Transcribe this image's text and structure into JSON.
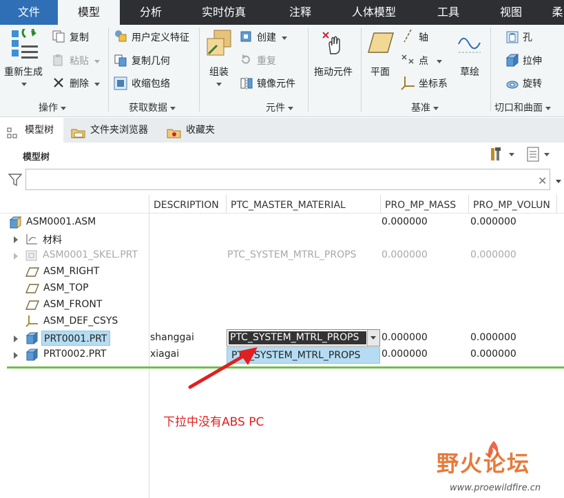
{
  "tabs": [
    "文件",
    "模型",
    "分析",
    "实时仿真",
    "注释",
    "人体模型",
    "工具",
    "视图",
    "柔"
  ],
  "active_tab": "模型",
  "ribbon": {
    "groups": {
      "operations": "操作",
      "get_data": "获取数据",
      "components": "元件",
      "datum": "基准",
      "cut_surface": "切口和曲面"
    },
    "regenerate": "重新生成",
    "copy": "复制",
    "paste": "粘贴",
    "delete": "删除",
    "user_defined_feature": "用户定义特征",
    "copy_geometry": "复制几何",
    "shrinkwrap": "收缩包络",
    "assemble": "组装",
    "create": "创建",
    "repeat": "重复",
    "mirror_component": "镜像元件",
    "drag_components": "拖动元件",
    "plane": "平面",
    "axis": "轴",
    "point": "点",
    "coordinate_system": "坐标系",
    "sketch": "草绘",
    "hole": "孔",
    "extrude": "拉伸",
    "revolve": "旋转"
  },
  "panel_tabs": [
    "模型树",
    "文件夹浏览器",
    "收藏夹"
  ],
  "tree": {
    "header": "模型树",
    "filter_placeholder": "",
    "columns": [
      "DESCRIPTION",
      "PTC_MASTER_MATERIAL",
      "PRO_MP_MASS",
      "PRO_MP_VOLUN"
    ],
    "rows": [
      {
        "name": "ASM0001.ASM",
        "description": "",
        "material": "",
        "mass": "0.000000",
        "volume": "0.000000"
      },
      {
        "name": "材料",
        "description": "",
        "material": "",
        "mass": "",
        "volume": ""
      },
      {
        "name": "ASM0001_SKEL.PRT",
        "description": "",
        "material": "PTC_SYSTEM_MTRL_PROPS",
        "mass": "0.000000",
        "volume": "0.000000"
      },
      {
        "name": "ASM_RIGHT",
        "description": "",
        "material": "",
        "mass": "",
        "volume": ""
      },
      {
        "name": "ASM_TOP",
        "description": "",
        "material": "",
        "mass": "",
        "volume": ""
      },
      {
        "name": "ASM_FRONT",
        "description": "",
        "material": "",
        "mass": "",
        "volume": ""
      },
      {
        "name": "ASM_DEF_CSYS",
        "description": "",
        "material": "",
        "mass": "",
        "volume": ""
      },
      {
        "name": "PRT0001.PRT",
        "description": "shanggai",
        "material": "PTC_SYSTEM_MTRL_PROPS",
        "mass": "0.000000",
        "volume": "0.000000"
      },
      {
        "name": "PRT0002.PRT",
        "description": "xiagai",
        "material": "",
        "mass": "0.000000",
        "volume": "0.000000"
      }
    ],
    "dropdown_option": "PTC_SYSTEM_MTRL_PROPS"
  },
  "annotation": "下拉中没有ABS PC",
  "watermark": {
    "title": "野火论坛",
    "url": "www.proewildfire.cn"
  },
  "colors": {
    "tabbar": "#2d2f33",
    "active_tab_text": "#1a1a1a",
    "highlight": "#b5dcf2",
    "annotation": "#e02020",
    "green_line": "#6cc04a"
  }
}
